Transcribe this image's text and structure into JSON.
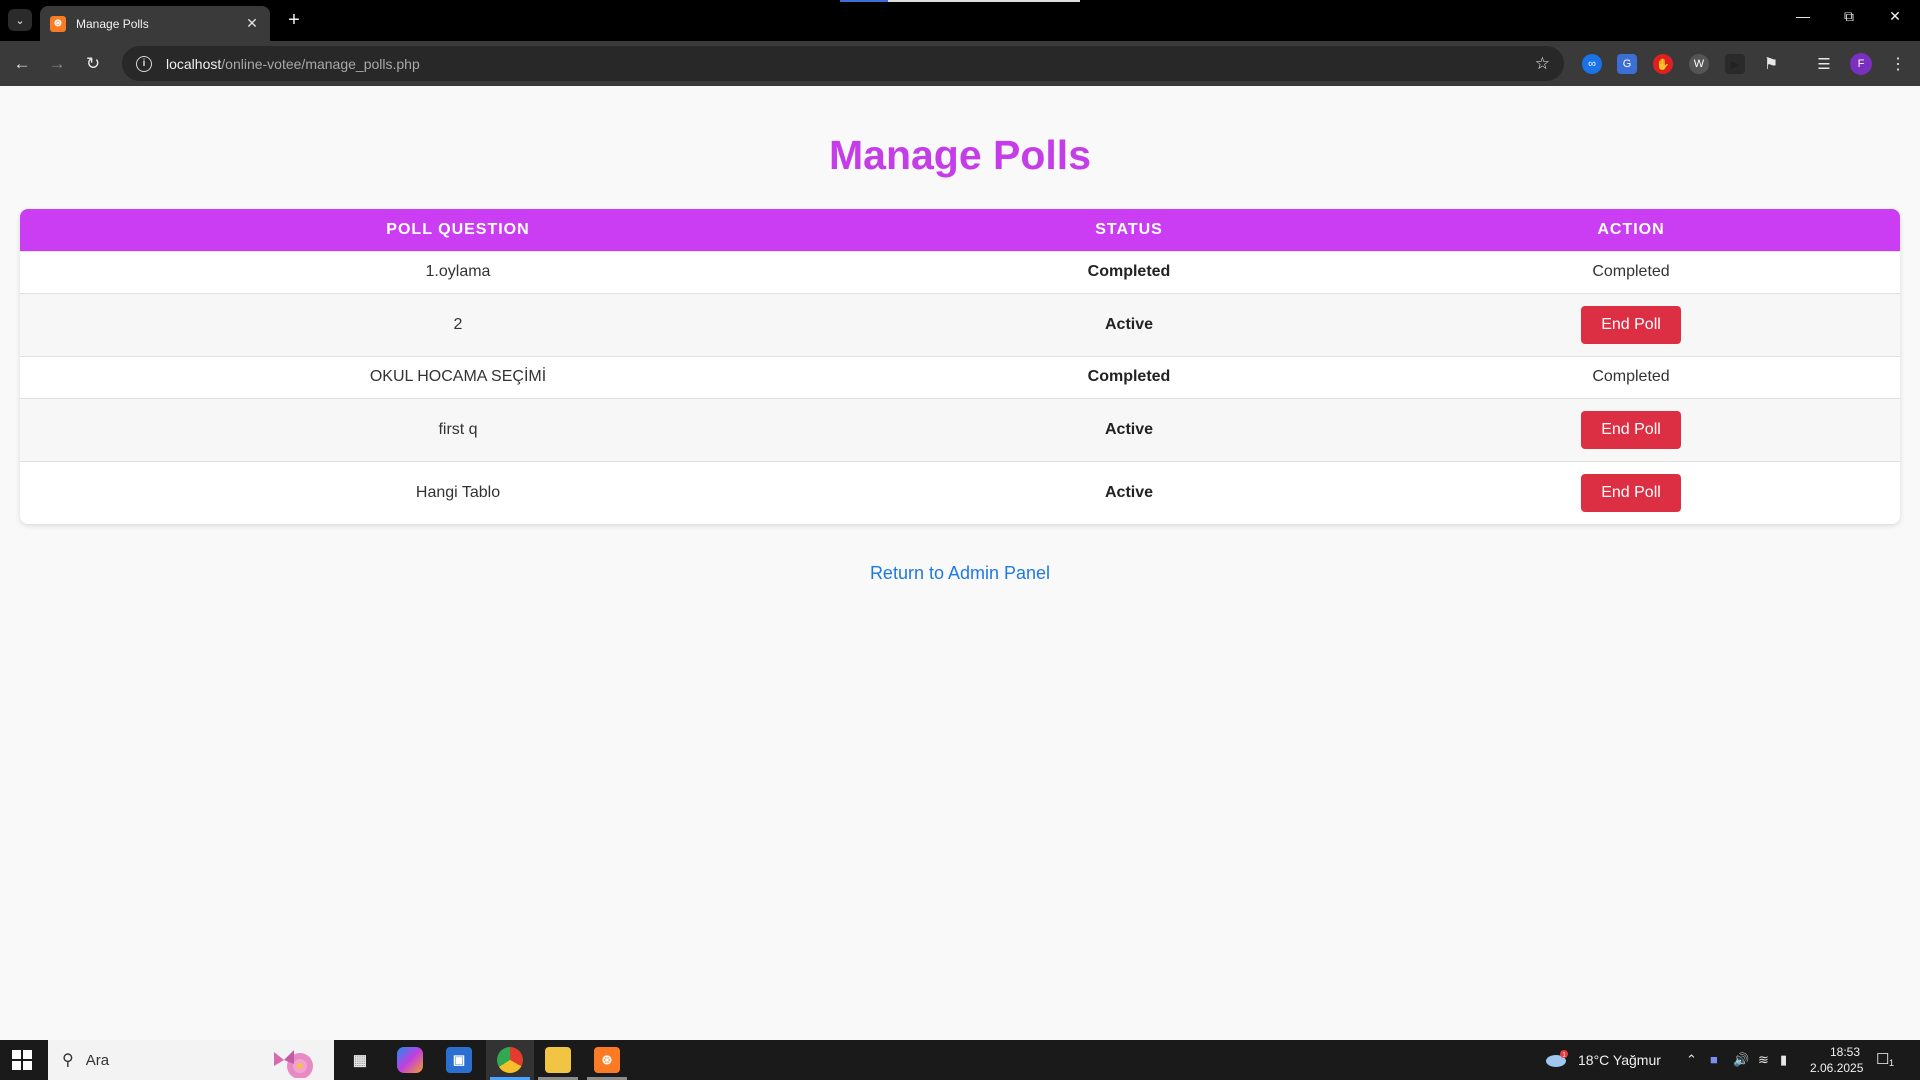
{
  "browser": {
    "tab_title": "Manage Polls",
    "tab_favicon": "xampp-icon",
    "url_host": "localhost",
    "url_path": "/online-votee/manage_polls.php",
    "profile_initial": "F"
  },
  "page": {
    "title": "Manage Polls",
    "title_color": "#c43de8",
    "header_color": "#cb3df2",
    "button_color": "#dc2f44",
    "link_color": "#1e7ae0",
    "table": {
      "headers": [
        "POLL QUESTION",
        "STATUS",
        "ACTION"
      ],
      "rows": [
        {
          "question": "1.oylama",
          "status": "Completed",
          "action": "Completed"
        },
        {
          "question": "2",
          "status": "Active",
          "action": "End Poll"
        },
        {
          "question": "OKUL HOCAMA SEÇİMİ",
          "status": "Completed",
          "action": "Completed"
        },
        {
          "question": "first q",
          "status": "Active",
          "action": "End Poll"
        },
        {
          "question": "Hangi Tablo",
          "status": "Active",
          "action": "End Poll"
        }
      ]
    },
    "return_link": "Return to Admin Panel"
  },
  "taskbar": {
    "search_placeholder": "Ara",
    "weather": "18°C  Yağmur",
    "weather_badge": "1",
    "time": "18:53",
    "date": "2.06.2025",
    "notification_count": "1"
  }
}
